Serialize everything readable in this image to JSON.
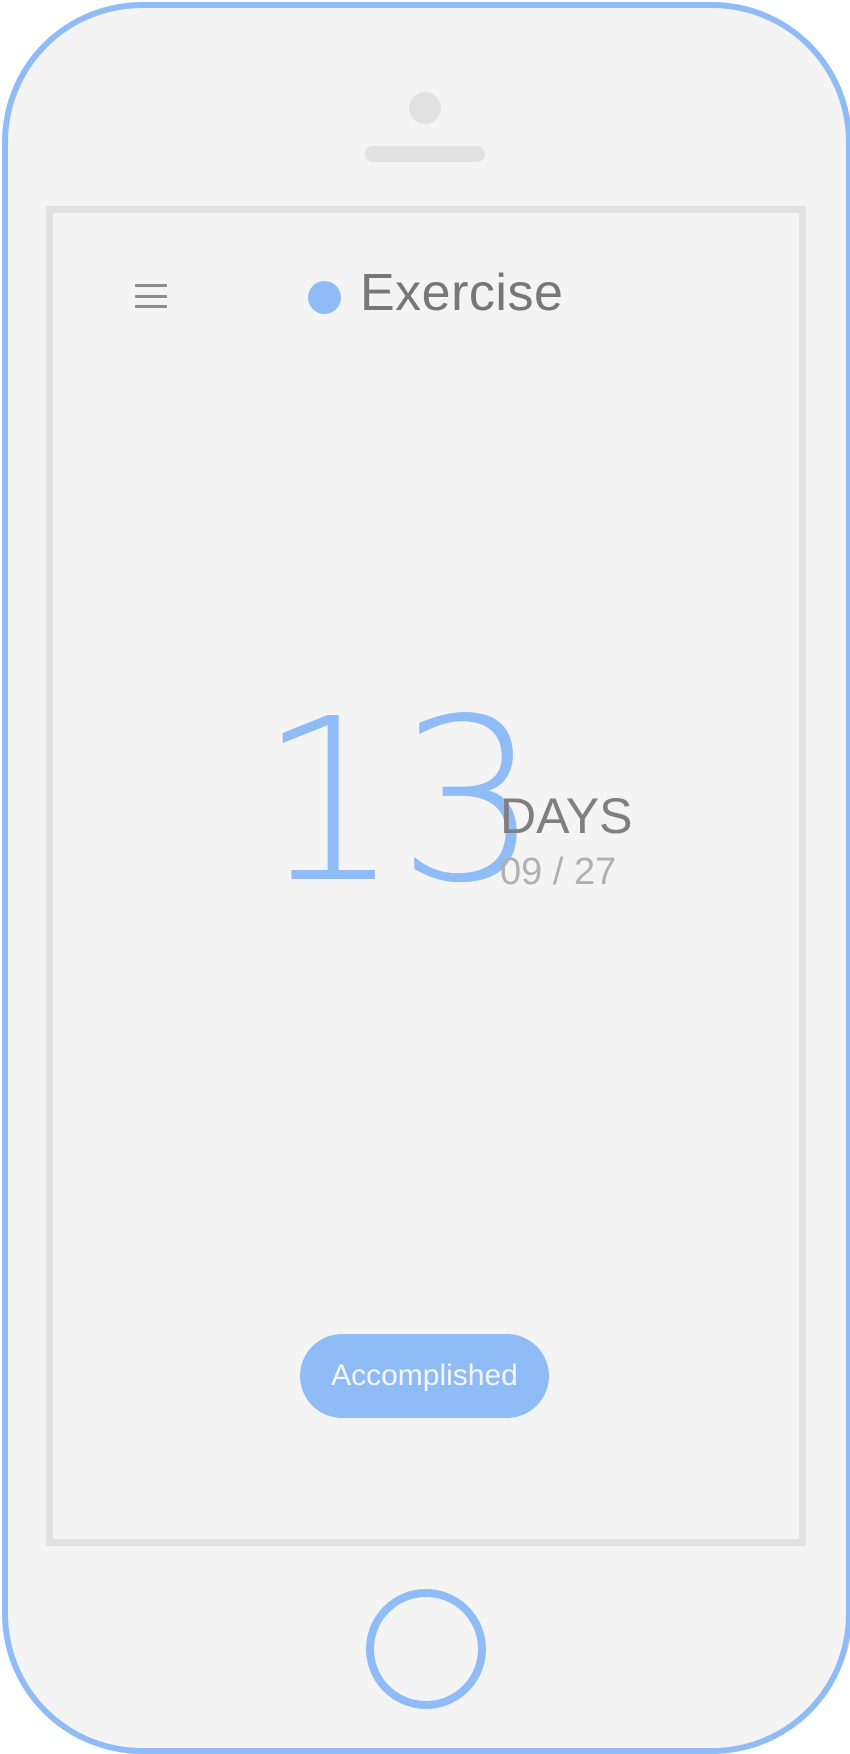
{
  "header": {
    "title": "Exercise",
    "accent_color": "#8fbcf7",
    "menu_icon": "hamburger-menu-icon",
    "status_dot_icon": "circle-dot-icon"
  },
  "counter": {
    "value": "13",
    "unit_label": "DAYS",
    "date": "09 / 27"
  },
  "actions": {
    "accomplished_label": "Accomplished"
  },
  "device": {
    "frame_color": "#8fbcf7",
    "home_button_icon": "home-button-icon"
  }
}
